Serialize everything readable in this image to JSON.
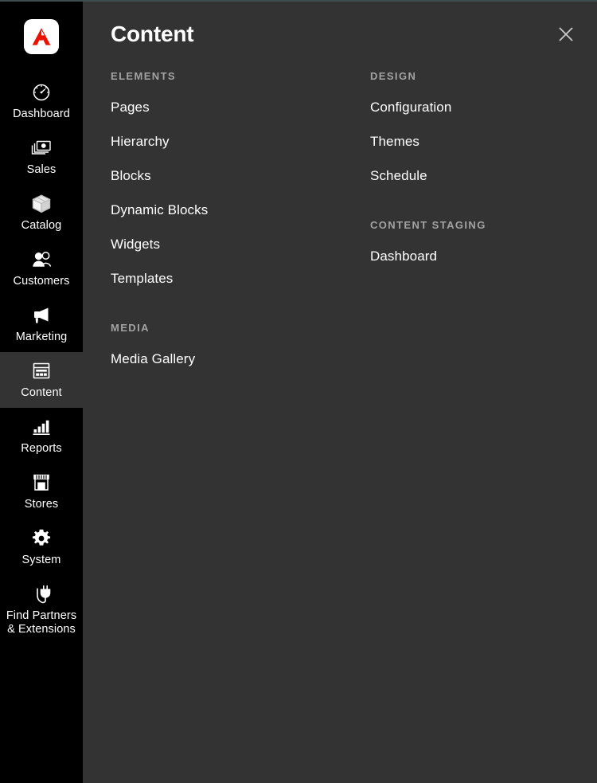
{
  "app": {
    "brand_logo": "adobe-logo",
    "brand_color": "#eb1000",
    "sidebar_bg": "#000000",
    "panel_bg": "#333333",
    "accent_text": "#a3a3a3"
  },
  "sidebar": {
    "items": [
      {
        "label": "Dashboard",
        "icon": "dashboard-gauge-icon",
        "active": false
      },
      {
        "label": "Sales",
        "icon": "money-stack-icon",
        "active": false
      },
      {
        "label": "Catalog",
        "icon": "box-icon",
        "active": false
      },
      {
        "label": "Customers",
        "icon": "people-icon",
        "active": false
      },
      {
        "label": "Marketing",
        "icon": "megaphone-icon",
        "active": false
      },
      {
        "label": "Content",
        "icon": "layout-page-icon",
        "active": true
      },
      {
        "label": "Reports",
        "icon": "bar-chart-icon",
        "active": false
      },
      {
        "label": "Stores",
        "icon": "storefront-icon",
        "active": false
      },
      {
        "label": "System",
        "icon": "gear-icon",
        "active": false
      },
      {
        "label": "Find Partners\n& Extensions",
        "icon": "power-plug-icon",
        "active": false
      }
    ]
  },
  "panel": {
    "title": "Content",
    "close_label": "close-icon",
    "left_column": [
      {
        "title": "ELEMENTS",
        "items": [
          "Pages",
          "Hierarchy",
          "Blocks",
          "Dynamic Blocks",
          "Widgets",
          "Templates"
        ]
      },
      {
        "title": "MEDIA",
        "items": [
          "Media Gallery"
        ]
      }
    ],
    "right_column": [
      {
        "title": "DESIGN",
        "items": [
          "Configuration",
          "Themes",
          "Schedule"
        ]
      },
      {
        "title": "CONTENT STAGING",
        "items": [
          "Dashboard"
        ]
      }
    ]
  }
}
